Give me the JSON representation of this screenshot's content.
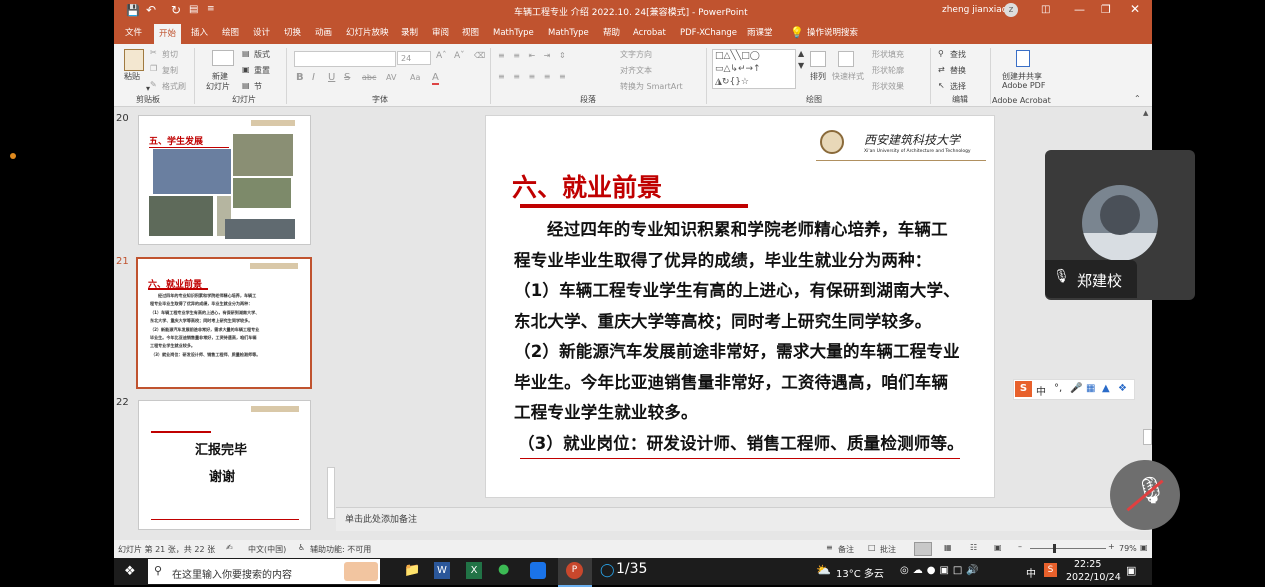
{
  "window": {
    "title": "车辆工程专业 介绍 2022.10. 24[兼容模式]  -  PowerPoint",
    "user": "zheng jianxiao",
    "user_initial": "z"
  },
  "tabs": [
    "文件",
    "开始",
    "插入",
    "绘图",
    "设计",
    "切换",
    "动画",
    "幻灯片放映",
    "录制",
    "审阅",
    "视图",
    "MathType",
    "MathType",
    "帮助",
    "Acrobat",
    "PDF-XChange",
    "雨课堂"
  ],
  "tell_me": "操作说明搜索",
  "ribbon": {
    "clipboard": {
      "label": "剪贴板",
      "paste": "粘贴",
      "cut": "剪切",
      "copy": "复制",
      "format_painter": "格式刷"
    },
    "slides": {
      "label": "幻灯片",
      "new_slide": "新建",
      "new_slide2": "幻灯片",
      "layout": "版式",
      "reset": "重置",
      "section": "节"
    },
    "font": {
      "label": "字体",
      "size": "24",
      "bold": "B",
      "italic": "I",
      "underline": "U",
      "strike": "S",
      "shadow": "abc",
      "spacing": "AV",
      "case": "Aa",
      "color": "A"
    },
    "paragraph": {
      "label": "段落",
      "text_direction": "文字方向",
      "align_text": "对齐文本",
      "smartart": "转换为 SmartArt"
    },
    "drawing": {
      "label": "绘图",
      "arrange": "排列",
      "quick_styles": "快速样式",
      "shape_fill": "形状填充",
      "shape_outline": "形状轮廓",
      "shape_effects": "形状效果"
    },
    "editing": {
      "label": "编辑",
      "find": "查找",
      "replace": "替换",
      "select": "选择"
    },
    "acrobat": {
      "label": "Adobe Acrobat",
      "create": "创建并共享",
      "create2": "Adobe PDF"
    }
  },
  "thumbnails": [
    {
      "num": "20",
      "title": "五、学生发展"
    },
    {
      "num": "21",
      "title": "六、就业前景",
      "lines": [
        "经过四年的专业知识积累和学院老师精心培养，车辆工",
        "程专业毕业生取得了优异的成绩，毕业生就业分为两种：",
        "（1）车辆工程专业学生有高的上进心，有保研到湖南大学、",
        "东北大学、重庆大学等高校；同时考上研究生同学较多。",
        "（2）新能源汽车发展前途非常好，需求大量的车辆工程专业",
        "毕业生。今年比亚迪销售量非常好，工资待遇高，咱们车辆",
        "工程专业学生就业较多。",
        "（3）就业岗位：研发设计师、销售工程师、质量检测师等。"
      ]
    },
    {
      "num": "22",
      "title": "汇报完毕",
      "subtitle": "谢谢"
    }
  ],
  "slide": {
    "university_cn": "西安建筑科技大学",
    "university_en": "Xi'an University of Architecture and Technology",
    "title": "六、就业前景",
    "body": [
      "经过四年的专业知识积累和学院老师精心培养，车辆工",
      "程专业毕业生取得了优异的成绩，毕业生就业分为两种：",
      "（1）车辆工程专业学生有高的上进心，有保研到湖南大学、",
      "东北大学、重庆大学等高校；同时考上研究生同学较多。",
      "（2）新能源汽车发展前途非常好，需求大量的车辆工程专业",
      "毕业生。今年比亚迪销售量非常好，工资待遇高，咱们车辆",
      "工程专业学生就业较多。",
      "（3）就业岗位：研发设计师、销售工程师、质量检测师等。"
    ]
  },
  "notes_placeholder": "单击此处添加备注",
  "status": {
    "slide_info": "幻灯片 第 21 张，共 22 张",
    "language": "中文(中国)",
    "accessibility": "辅助功能: 不可用",
    "notes": "备注",
    "comments": "批注",
    "zoom": "79%"
  },
  "video": {
    "name": "郑建校"
  },
  "ime": {
    "logo": "S",
    "mode": "中",
    "punct": "°,"
  },
  "taskbar": {
    "search_placeholder": "在这里输入你要搜索的内容",
    "page_counter": "1/35",
    "weather": "13°C  多云",
    "ime": "中",
    "time": "22:25",
    "date": "2022/10/24"
  },
  "colors": {
    "accent": "#c0532f",
    "title_red": "#c00000"
  }
}
